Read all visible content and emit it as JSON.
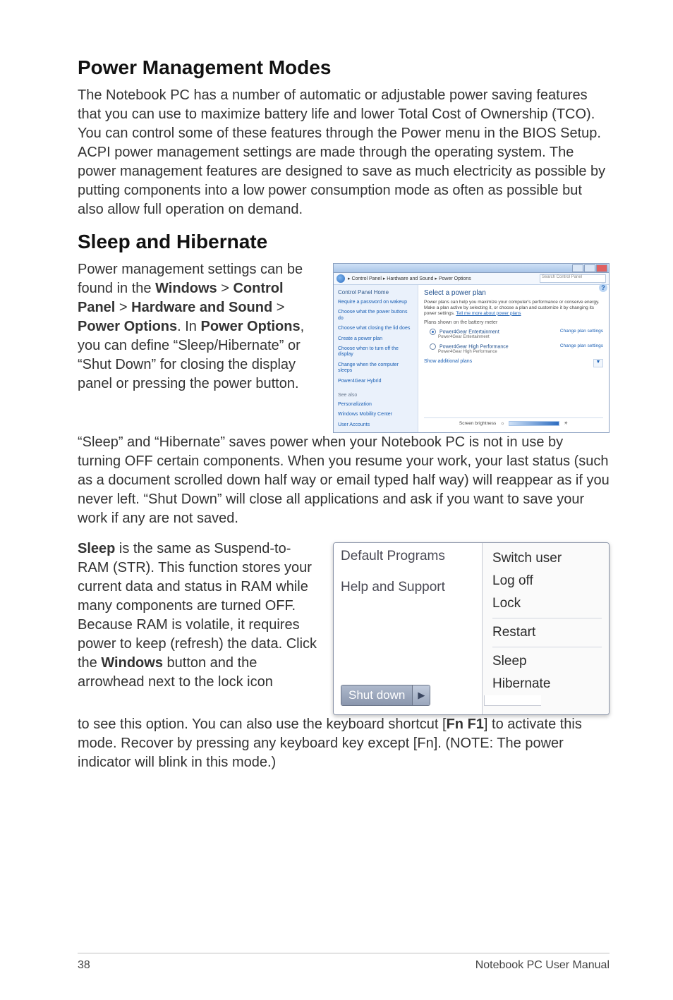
{
  "section1": {
    "heading": "Power Management Modes",
    "para": "The Notebook PC has a number of automatic or adjustable power saving features that you can use to maximize battery life and lower Total Cost of Ownership (TCO). You can control some of these features through the Power menu in the BIOS Setup. ACPI power management settings are made through the operating system. The power management features are designed to save as much electricity as possible by putting components into a low power consumption mode as often as possible but also allow full operation on demand."
  },
  "section2": {
    "heading": "Sleep and Hibernate",
    "para1_pre": "Power management settings can be found in the ",
    "para1_b1": "Windows",
    "para1_mid1": " > ",
    "para1_b2": "Control Panel",
    "para1_mid2": " > ",
    "para1_b3": "Hardware and Sound",
    "para1_mid3": " > ",
    "para1_b4": "Power Options",
    "para1_mid4": ". In ",
    "para1_b5": "Power Options",
    "para1_post": ", you can define “Sleep/Hibernate” or “Shut Down” for closing the display panel or pressing the power button.",
    "para2": "“Sleep” and “Hibernate” saves power when your Notebook PC is not in use by turning OFF certain components. When you resume your work, your last status (such as a document scrolled down half way or email typed half way) will reappear as if you never left. “Shut Down” will close all applications and ask if you want to save your work if any are not saved.",
    "para3_b1": "Sleep",
    "para3_mid1": " is the same as Suspend-to-RAM (STR). This function stores your current data and status in RAM while many components are turned OFF. Because RAM is volatile, it requires power to keep (refresh) the data. Click the ",
    "para3_b2": "Windows",
    "para3_post": " button and the arrowhead next to the lock icon",
    "para4_pre": "to see this option. You can also use the keyboard shortcut [",
    "para4_b1": "Fn F1",
    "para4_post": "] to activate this mode. Recover by pressing any keyboard key except [Fn]. (NOTE: The power indicator will blink in this mode.)"
  },
  "power_options_window": {
    "breadcrumb": "▸ Control Panel ▸ Hardware and Sound ▸ Power Options",
    "search_placeholder": "Search Control Panel",
    "side_header": "Control Panel Home",
    "side_links": [
      "Require a password on wakeup",
      "Choose what the power buttons do",
      "Choose what closing the lid does",
      "Create a power plan",
      "Choose when to turn off the display",
      "Change when the computer sleeps",
      "Power4Gear Hybrid"
    ],
    "see_also_label": "See also",
    "see_also": [
      "Personalization",
      "Windows Mobility Center",
      "User Accounts"
    ],
    "main_title": "Select a power plan",
    "main_desc": "Power plans can help you maximize your computer's performance or conserve energy. Make a plan active by selecting it, or choose a plan and customize it by changing its power settings. ",
    "main_desc_link": "Tell me more about power plans",
    "group_label": "Plans shown on the battery meter",
    "plans": [
      {
        "name": "Power4Gear Entertainment",
        "sub": "Power4Gear Entertainment",
        "selected": true
      },
      {
        "name": "Power4Gear High Performance",
        "sub": "Power4Gear High Performance",
        "selected": false
      }
    ],
    "change_label": "Change plan settings",
    "show_more": "Show additional plans",
    "expand_glyph": "▼",
    "footer_label": "Screen brightness"
  },
  "start_menu": {
    "left_items": [
      "Default Programs",
      "Help and Support"
    ],
    "shutdown_label": "Shut down",
    "arrow_glyph": "▶",
    "right_items_top": [
      "Switch user",
      "Log off",
      "Lock"
    ],
    "right_items_mid": [
      "Restart"
    ],
    "right_items_bot": [
      "Sleep",
      "Hibernate"
    ]
  },
  "footer": {
    "page": "38",
    "title": "Notebook PC User Manual"
  }
}
